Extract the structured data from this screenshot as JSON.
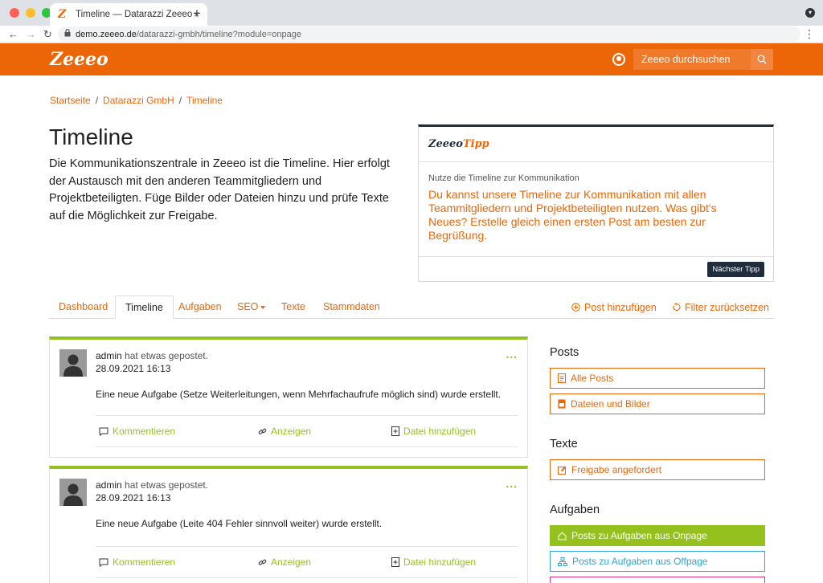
{
  "browser": {
    "tab_title": "Timeline — Datarazzi Zeeeo",
    "tab_favicon": "Z",
    "tab_close": "×",
    "new_tab": "+",
    "url_host": "demo.zeeeo.de",
    "url_path": "/datarazzi-gmbh/timeline?module=onpage",
    "back": "←",
    "forward": "→",
    "reload": "↻",
    "menu": "⋮",
    "window_menu": "▾",
    "dot_colors": [
      "#ff5f57",
      "#febc2e",
      "#28c840"
    ]
  },
  "header": {
    "logo": "Zeeeo",
    "search_placeholder": "Zeeeo durchsuchen",
    "brand_color": "#ec6608"
  },
  "breadcrumb": {
    "items": [
      "Startseite",
      "Datarazzi GmbH",
      "Timeline"
    ],
    "separator": "/"
  },
  "page": {
    "title": "Timeline",
    "intro": "Die Kommunikationszentrale in Zeeeo ist die Timeline. Hier erfolgt der Austausch mit den anderen Teammitgliedern und Projektbeteiligten. Füge Bilder oder Dateien hinzu und prüfe Texte auf die Möglichkeit zur Freigabe."
  },
  "tipp": {
    "brand_a": "Zeeeo",
    "brand_b": "Tipp",
    "subtitle": "Nutze die Timeline zur Kommunikation",
    "message": "Du kannst unsere Timeline zur Kommunikation mit allen Teammitgliedern und Projektbeteiligten nutzen. Was gibt's Neues? Erstelle gleich einen ersten Post am besten zur Begrüßung.",
    "button": "Nächster Tipp"
  },
  "tabs": {
    "items": [
      "Dashboard",
      "Timeline",
      "Aufgaben",
      "SEO",
      "Texte",
      "Stammdaten"
    ],
    "active": "Timeline",
    "add_post": "Post hinzufügen",
    "reset_filter": "Filter zurücksetzen"
  },
  "posts": [
    {
      "author": "admin",
      "action": "hat etwas gepostet.",
      "date": "28.09.2021 16:13",
      "text": "Eine neue Aufgabe (Setze Weiterleitungen, wenn Mehrfachaufrufe möglich sind) wurde erstellt.",
      "menu": "..."
    },
    {
      "author": "admin",
      "action": "hat etwas gepostet.",
      "date": "28.09.2021 16:13",
      "text": "Eine neue Aufgabe (Leite 404 Fehler sinnvoll weiter) wurde erstellt.",
      "menu": "..."
    }
  ],
  "post_actions": {
    "comment": "Kommentieren",
    "show": "Anzeigen",
    "add_file": "Datei hinzufügen",
    "accent": "#95c11f"
  },
  "sidebar": {
    "posts_heading": "Posts",
    "posts_items": [
      "Alle Posts",
      "Dateien und Bilder"
    ],
    "texte_heading": "Texte",
    "texte_items": [
      "Freigabe angefordert"
    ],
    "aufgaben_heading": "Aufgaben",
    "aufgaben_items": [
      "Posts zu Aufgaben aus Onpage",
      "Posts zu Aufgaben aus Offpage"
    ]
  }
}
